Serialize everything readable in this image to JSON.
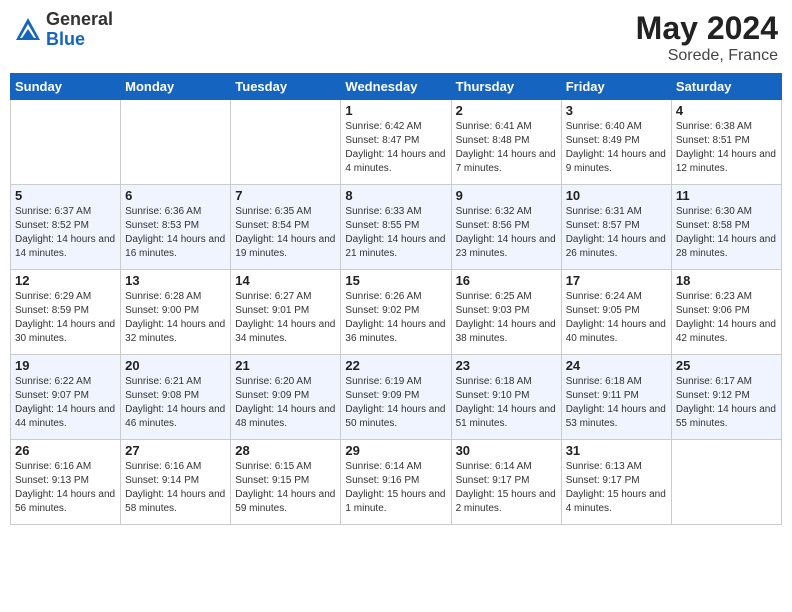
{
  "header": {
    "logo_general": "General",
    "logo_blue": "Blue",
    "month": "May 2024",
    "location": "Sorede, France"
  },
  "days_of_week": [
    "Sunday",
    "Monday",
    "Tuesday",
    "Wednesday",
    "Thursday",
    "Friday",
    "Saturday"
  ],
  "weeks": [
    [
      {
        "day": "",
        "empty": true
      },
      {
        "day": "",
        "empty": true
      },
      {
        "day": "",
        "empty": true
      },
      {
        "day": "1",
        "sunrise": "Sunrise: 6:42 AM",
        "sunset": "Sunset: 8:47 PM",
        "daylight": "Daylight: 14 hours and 4 minutes."
      },
      {
        "day": "2",
        "sunrise": "Sunrise: 6:41 AM",
        "sunset": "Sunset: 8:48 PM",
        "daylight": "Daylight: 14 hours and 7 minutes."
      },
      {
        "day": "3",
        "sunrise": "Sunrise: 6:40 AM",
        "sunset": "Sunset: 8:49 PM",
        "daylight": "Daylight: 14 hours and 9 minutes."
      },
      {
        "day": "4",
        "sunrise": "Sunrise: 6:38 AM",
        "sunset": "Sunset: 8:51 PM",
        "daylight": "Daylight: 14 hours and 12 minutes."
      }
    ],
    [
      {
        "day": "5",
        "sunrise": "Sunrise: 6:37 AM",
        "sunset": "Sunset: 8:52 PM",
        "daylight": "Daylight: 14 hours and 14 minutes."
      },
      {
        "day": "6",
        "sunrise": "Sunrise: 6:36 AM",
        "sunset": "Sunset: 8:53 PM",
        "daylight": "Daylight: 14 hours and 16 minutes."
      },
      {
        "day": "7",
        "sunrise": "Sunrise: 6:35 AM",
        "sunset": "Sunset: 8:54 PM",
        "daylight": "Daylight: 14 hours and 19 minutes."
      },
      {
        "day": "8",
        "sunrise": "Sunrise: 6:33 AM",
        "sunset": "Sunset: 8:55 PM",
        "daylight": "Daylight: 14 hours and 21 minutes."
      },
      {
        "day": "9",
        "sunrise": "Sunrise: 6:32 AM",
        "sunset": "Sunset: 8:56 PM",
        "daylight": "Daylight: 14 hours and 23 minutes."
      },
      {
        "day": "10",
        "sunrise": "Sunrise: 6:31 AM",
        "sunset": "Sunset: 8:57 PM",
        "daylight": "Daylight: 14 hours and 26 minutes."
      },
      {
        "day": "11",
        "sunrise": "Sunrise: 6:30 AM",
        "sunset": "Sunset: 8:58 PM",
        "daylight": "Daylight: 14 hours and 28 minutes."
      }
    ],
    [
      {
        "day": "12",
        "sunrise": "Sunrise: 6:29 AM",
        "sunset": "Sunset: 8:59 PM",
        "daylight": "Daylight: 14 hours and 30 minutes."
      },
      {
        "day": "13",
        "sunrise": "Sunrise: 6:28 AM",
        "sunset": "Sunset: 9:00 PM",
        "daylight": "Daylight: 14 hours and 32 minutes."
      },
      {
        "day": "14",
        "sunrise": "Sunrise: 6:27 AM",
        "sunset": "Sunset: 9:01 PM",
        "daylight": "Daylight: 14 hours and 34 minutes."
      },
      {
        "day": "15",
        "sunrise": "Sunrise: 6:26 AM",
        "sunset": "Sunset: 9:02 PM",
        "daylight": "Daylight: 14 hours and 36 minutes."
      },
      {
        "day": "16",
        "sunrise": "Sunrise: 6:25 AM",
        "sunset": "Sunset: 9:03 PM",
        "daylight": "Daylight: 14 hours and 38 minutes."
      },
      {
        "day": "17",
        "sunrise": "Sunrise: 6:24 AM",
        "sunset": "Sunset: 9:05 PM",
        "daylight": "Daylight: 14 hours and 40 minutes."
      },
      {
        "day": "18",
        "sunrise": "Sunrise: 6:23 AM",
        "sunset": "Sunset: 9:06 PM",
        "daylight": "Daylight: 14 hours and 42 minutes."
      }
    ],
    [
      {
        "day": "19",
        "sunrise": "Sunrise: 6:22 AM",
        "sunset": "Sunset: 9:07 PM",
        "daylight": "Daylight: 14 hours and 44 minutes."
      },
      {
        "day": "20",
        "sunrise": "Sunrise: 6:21 AM",
        "sunset": "Sunset: 9:08 PM",
        "daylight": "Daylight: 14 hours and 46 minutes."
      },
      {
        "day": "21",
        "sunrise": "Sunrise: 6:20 AM",
        "sunset": "Sunset: 9:09 PM",
        "daylight": "Daylight: 14 hours and 48 minutes."
      },
      {
        "day": "22",
        "sunrise": "Sunrise: 6:19 AM",
        "sunset": "Sunset: 9:09 PM",
        "daylight": "Daylight: 14 hours and 50 minutes."
      },
      {
        "day": "23",
        "sunrise": "Sunrise: 6:18 AM",
        "sunset": "Sunset: 9:10 PM",
        "daylight": "Daylight: 14 hours and 51 minutes."
      },
      {
        "day": "24",
        "sunrise": "Sunrise: 6:18 AM",
        "sunset": "Sunset: 9:11 PM",
        "daylight": "Daylight: 14 hours and 53 minutes."
      },
      {
        "day": "25",
        "sunrise": "Sunrise: 6:17 AM",
        "sunset": "Sunset: 9:12 PM",
        "daylight": "Daylight: 14 hours and 55 minutes."
      }
    ],
    [
      {
        "day": "26",
        "sunrise": "Sunrise: 6:16 AM",
        "sunset": "Sunset: 9:13 PM",
        "daylight": "Daylight: 14 hours and 56 minutes."
      },
      {
        "day": "27",
        "sunrise": "Sunrise: 6:16 AM",
        "sunset": "Sunset: 9:14 PM",
        "daylight": "Daylight: 14 hours and 58 minutes."
      },
      {
        "day": "28",
        "sunrise": "Sunrise: 6:15 AM",
        "sunset": "Sunset: 9:15 PM",
        "daylight": "Daylight: 14 hours and 59 minutes."
      },
      {
        "day": "29",
        "sunrise": "Sunrise: 6:14 AM",
        "sunset": "Sunset: 9:16 PM",
        "daylight": "Daylight: 15 hours and 1 minute."
      },
      {
        "day": "30",
        "sunrise": "Sunrise: 6:14 AM",
        "sunset": "Sunset: 9:17 PM",
        "daylight": "Daylight: 15 hours and 2 minutes."
      },
      {
        "day": "31",
        "sunrise": "Sunrise: 6:13 AM",
        "sunset": "Sunset: 9:17 PM",
        "daylight": "Daylight: 15 hours and 4 minutes."
      },
      {
        "day": "",
        "empty": true
      }
    ]
  ]
}
